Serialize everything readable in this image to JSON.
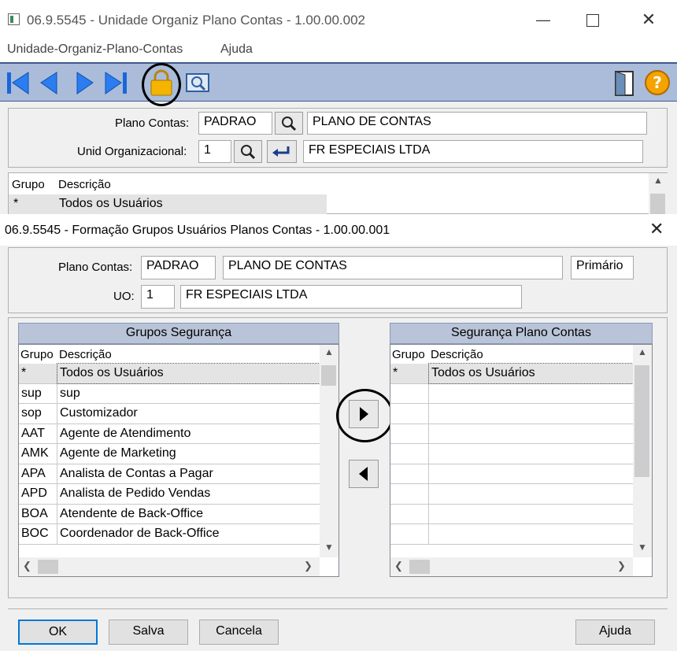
{
  "bg_window": {
    "title": "06.9.5545 - Unidade Organiz Plano Contas - 1.00.00.002",
    "menu": [
      "Unidade-Organiz-Plano-Contas",
      "Ajuda"
    ],
    "plano_contas_label": "Plano Contas:",
    "plano_contas_code": "PADRAO",
    "plano_contas_desc": "PLANO DE CONTAS",
    "unid_label": "Unid Organizacional:",
    "unid_code": "1",
    "unid_desc": "FR ESPECIAIS LTDA",
    "grid_headers": [
      "Grupo",
      "Descrição"
    ],
    "grid_rows": [
      {
        "grupo": "*",
        "descricao": "Todos os Usuários"
      }
    ]
  },
  "dialog": {
    "title": "06.9.5545 - Formação Grupos Usuários Planos Contas - 1.00.00.001",
    "plano_contas_label": "Plano Contas:",
    "plano_contas_code": "PADRAO",
    "plano_contas_desc": "PLANO DE CONTAS",
    "tipo": "Primário",
    "uo_label": "UO:",
    "uo_code": "1",
    "uo_desc": "FR ESPECIAIS LTDA",
    "left_list": {
      "title": "Grupos Segurança",
      "headers": [
        "Grupo",
        "Descrição"
      ],
      "rows": [
        {
          "grupo": "*",
          "descricao": "Todos os Usuários"
        },
        {
          "grupo": "sup",
          "descricao": "sup"
        },
        {
          "grupo": "sop",
          "descricao": "Customizador"
        },
        {
          "grupo": "AAT",
          "descricao": "Agente de Atendimento"
        },
        {
          "grupo": "AMK",
          "descricao": "Agente de Marketing"
        },
        {
          "grupo": "APA",
          "descricao": "Analista de Contas a Pagar"
        },
        {
          "grupo": "APD",
          "descricao": "Analista de Pedido Vendas"
        },
        {
          "grupo": "BOA",
          "descricao": "Atendente de Back-Office"
        },
        {
          "grupo": "BOC",
          "descricao": "Coordenador de Back-Office"
        }
      ]
    },
    "right_list": {
      "title": "Segurança Plano Contas",
      "headers": [
        "Grupo",
        "Descrição"
      ],
      "rows": [
        {
          "grupo": "*",
          "descricao": "Todos os Usuários"
        }
      ]
    },
    "buttons": {
      "ok": "OK",
      "salva": "Salva",
      "cancela": "Cancela",
      "ajuda": "Ajuda"
    }
  },
  "colors": {
    "toolbar_bg": "#aabcd9",
    "list_title_bg": "#b9c4d8",
    "selected_row": "#e4e4e4",
    "ok_border": "#0078d7"
  }
}
